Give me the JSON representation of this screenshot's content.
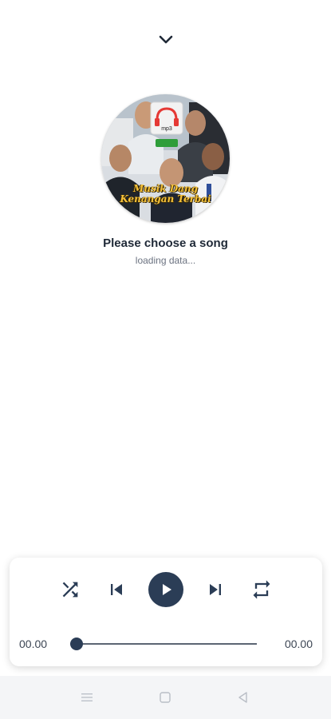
{
  "header": {
    "collapse_icon": "chevron-down-icon"
  },
  "album": {
    "badge_label": "mp3",
    "banner_line1": "Musik Dang",
    "banner_line2": "Kenangan Terbai"
  },
  "now_playing": {
    "title": "Please choose a song",
    "subtitle": "loading data..."
  },
  "controls": {
    "shuffle_icon": "shuffle-icon",
    "previous_icon": "skip-previous-icon",
    "play_icon": "play-icon",
    "next_icon": "skip-next-icon",
    "repeat_icon": "repeat-icon",
    "accent_color": "#2b3d56"
  },
  "progress": {
    "elapsed": "00.00",
    "duration": "00.00",
    "position": 0
  },
  "system_nav": {
    "menu_icon": "menu-icon",
    "home_icon": "home-icon",
    "back_icon": "back-icon"
  }
}
